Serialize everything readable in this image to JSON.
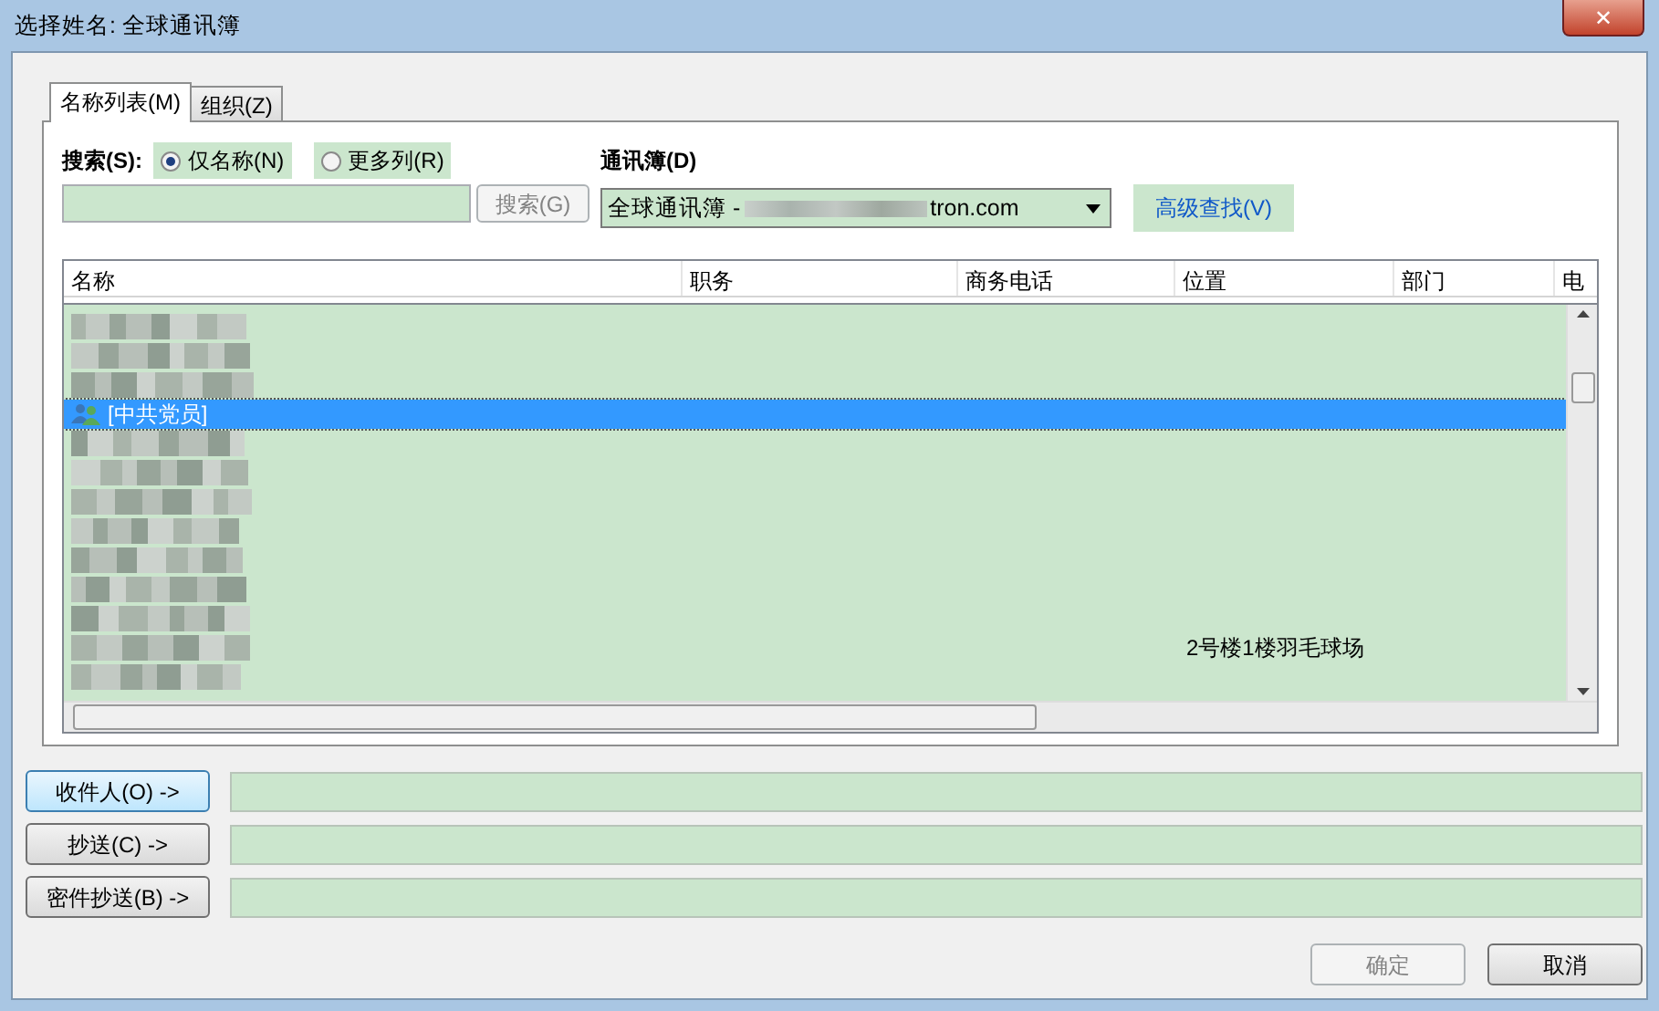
{
  "window": {
    "title": "选择姓名: 全球通讯簿",
    "close": "✕"
  },
  "tabs": [
    {
      "label": "名称列表(M)",
      "selected": true
    },
    {
      "label": "组织(Z)",
      "selected": false
    }
  ],
  "search": {
    "label": "搜索(S):",
    "options": [
      {
        "label": "仅名称(N)",
        "selected": true
      },
      {
        "label": "更多列(R)",
        "selected": false
      }
    ],
    "button": "搜索(G)",
    "button_disabled": true
  },
  "address_book": {
    "label": "通讯簿(D)",
    "value_start": "全球通讯簿 -",
    "value_end": "tron.com",
    "advanced": "高级查找(V)"
  },
  "table": {
    "columns": [
      "名称",
      "职务",
      "商务电话",
      "位置",
      "部门",
      "电"
    ],
    "rows": [
      {
        "kind": "blurred",
        "selected": false
      },
      {
        "kind": "blurred",
        "selected": false
      },
      {
        "kind": "blurred",
        "selected": false
      },
      {
        "kind": "group",
        "name": "[中共党员]",
        "selected": true
      },
      {
        "kind": "blurred",
        "selected": false
      },
      {
        "kind": "blurred",
        "selected": false
      },
      {
        "kind": "blurred",
        "selected": false
      },
      {
        "kind": "blurred",
        "selected": false
      },
      {
        "kind": "blurred",
        "selected": false
      },
      {
        "kind": "blurred",
        "selected": false
      },
      {
        "kind": "blurred",
        "selected": false
      },
      {
        "kind": "entry",
        "location": "2号楼1楼羽毛球场",
        "selected": false
      },
      {
        "kind": "blurred",
        "selected": false
      }
    ]
  },
  "recipients": [
    {
      "button": "收件人(O) ->"
    },
    {
      "button": "抄送(C) ->"
    },
    {
      "button": "密件抄送(B) ->"
    }
  ],
  "buttons": [
    {
      "label": "确定",
      "disabled": true
    },
    {
      "label": "取消",
      "disabled": false
    }
  ]
}
